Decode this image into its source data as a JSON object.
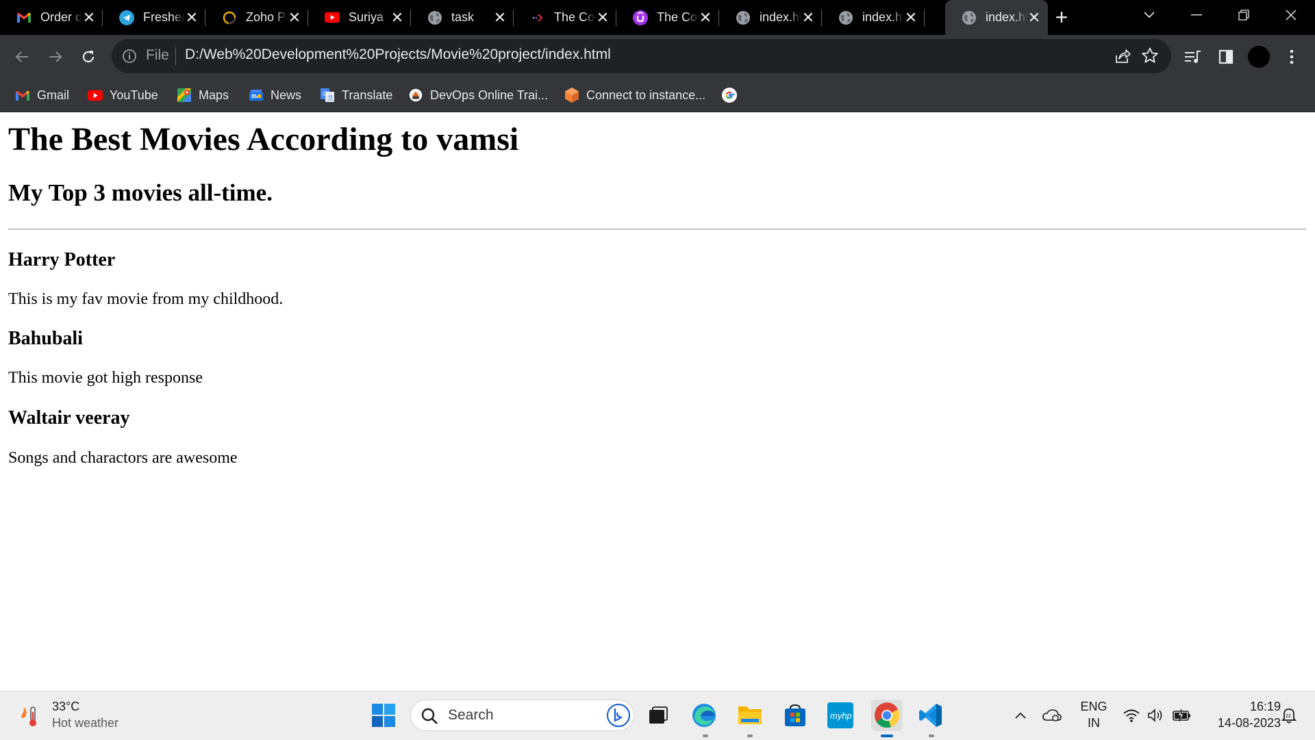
{
  "browser": {
    "tabs": [
      {
        "title": "Order details",
        "icon": "gmail-icon",
        "active": false
      },
      {
        "title": "Freshers Jobs",
        "icon": "telegram-icon",
        "active": false
      },
      {
        "title": "Zoho People",
        "icon": "zoho-icon",
        "active": false
      },
      {
        "title": "Suriya",
        "icon": "youtube-icon",
        "active": false
      },
      {
        "title": "task",
        "icon": "globe-icon",
        "active": false
      },
      {
        "title": "The Complete",
        "icon": "arrow-icon",
        "active": false
      },
      {
        "title": "The Complete",
        "icon": "udemy-icon",
        "active": false
      },
      {
        "title": "index.html",
        "icon": "globe-icon",
        "active": false
      },
      {
        "title": "index.html",
        "icon": "globe-icon",
        "active": false
      },
      {
        "title": "index.html",
        "icon": "globe-icon",
        "active": true
      }
    ],
    "omnibox": {
      "scheme_label": "File",
      "url": "D:/Web%20Development%20Projects/Movie%20project/index.html"
    },
    "bookmarks": [
      {
        "label": "Gmail",
        "icon": "gmail-icon"
      },
      {
        "label": "YouTube",
        "icon": "youtube-icon"
      },
      {
        "label": "Maps",
        "icon": "maps-icon"
      },
      {
        "label": "News",
        "icon": "news-icon"
      },
      {
        "label": "Translate",
        "icon": "translate-icon"
      },
      {
        "label": "DevOps Online Trai...",
        "icon": "devops-icon"
      },
      {
        "label": "Connect to instance...",
        "icon": "aws-icon"
      },
      {
        "label": "",
        "icon": "google-icon"
      }
    ]
  },
  "page": {
    "heading": "The Best Movies According to vamsi",
    "subheading": "My Top 3 movies all-time.",
    "movies": [
      {
        "title": "Harry Potter",
        "description": "This is my fav movie from my childhood."
      },
      {
        "title": "Bahubali",
        "description": "This movie got high response"
      },
      {
        "title": "Waltair veeray",
        "description": "Songs and charactors are awesome"
      }
    ]
  },
  "taskbar": {
    "weather_temp": "33°C",
    "weather_desc": "Hot weather",
    "search_placeholder": "Search",
    "lang_line1": "ENG",
    "lang_line2": "IN",
    "time": "16:19",
    "date": "14-08-2023"
  },
  "colors": {
    "tab_strip_bg": "#000000",
    "toolbar_bg": "#35363a",
    "omnibox_bg": "#202124",
    "taskbar_bg": "#eeeeee",
    "accent": "#0067c0"
  }
}
